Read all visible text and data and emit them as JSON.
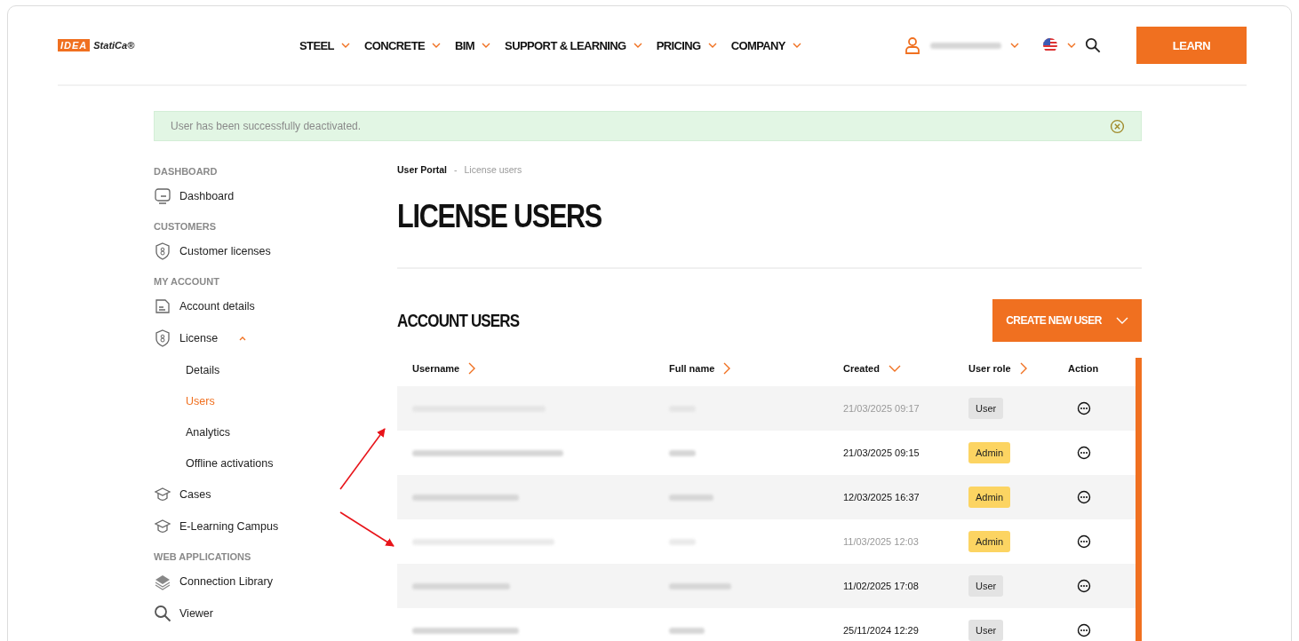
{
  "header": {
    "logo": {
      "mark": "IDEA",
      "text": "StatiCa®"
    },
    "nav": [
      {
        "label": "STEEL"
      },
      {
        "label": "CONCRETE"
      },
      {
        "label": "BIM"
      },
      {
        "label": "SUPPORT & LEARNING"
      },
      {
        "label": "PRICING"
      },
      {
        "label": "COMPANY"
      }
    ],
    "learn_button": "LEARN"
  },
  "alert": {
    "message": "User has been successfully deactivated."
  },
  "sidebar": [
    {
      "kind": "heading",
      "label": "DASHBOARD"
    },
    {
      "kind": "item",
      "label": "Dashboard",
      "selected": false
    },
    {
      "kind": "heading",
      "label": "CUSTOMERS"
    },
    {
      "kind": "item",
      "label": "Customer licenses",
      "selected": false
    },
    {
      "kind": "heading",
      "label": "MY ACCOUNT"
    },
    {
      "kind": "item",
      "label": "Account details",
      "selected": false
    },
    {
      "kind": "item",
      "label": "License",
      "selected": false,
      "expanded": true,
      "children": [
        {
          "label": "Details",
          "selected": false
        },
        {
          "label": "Users",
          "selected": true
        },
        {
          "label": "Analytics",
          "selected": false
        },
        {
          "label": "Offline activations",
          "selected": false
        }
      ]
    },
    {
      "kind": "item",
      "label": "Cases",
      "selected": false
    },
    {
      "kind": "item",
      "label": "E-Learning Campus",
      "selected": false
    },
    {
      "kind": "heading",
      "label": "WEB APPLICATIONS"
    },
    {
      "kind": "item",
      "label": "Connection Library",
      "selected": false
    },
    {
      "kind": "item",
      "label": "Viewer",
      "selected": false
    }
  ],
  "breadcrumb": {
    "root": "User Portal",
    "separator": "-",
    "current": "License users"
  },
  "page_title": "LICENSE USERS",
  "section_title": "ACCOUNT USERS",
  "create_button": "CREATE NEW USER",
  "table": {
    "columns": [
      {
        "label": "Username",
        "sortable": true,
        "sorted": false
      },
      {
        "label": "Full name",
        "sortable": true,
        "sorted": false
      },
      {
        "label": "Created",
        "sortable": true,
        "sorted": true
      },
      {
        "label": "User role",
        "sortable": true,
        "sorted": false
      },
      {
        "label": "Action",
        "sortable": false
      }
    ],
    "rows": [
      {
        "created": "21/03/2025 09:17",
        "role": "User",
        "kind": "user",
        "disabled": true
      },
      {
        "created": "21/03/2025 09:15",
        "role": "Admin",
        "kind": "admin",
        "disabled": false
      },
      {
        "created": "12/03/2025 16:37",
        "role": "Admin",
        "kind": "admin",
        "disabled": false
      },
      {
        "created": "11/03/2025 12:03",
        "role": "Admin",
        "kind": "admin",
        "disabled": true
      },
      {
        "created": "11/02/2025 17:08",
        "role": "User",
        "kind": "user",
        "disabled": false
      },
      {
        "created": "25/11/2024 12:29",
        "role": "User",
        "kind": "user",
        "disabled": false
      }
    ]
  }
}
